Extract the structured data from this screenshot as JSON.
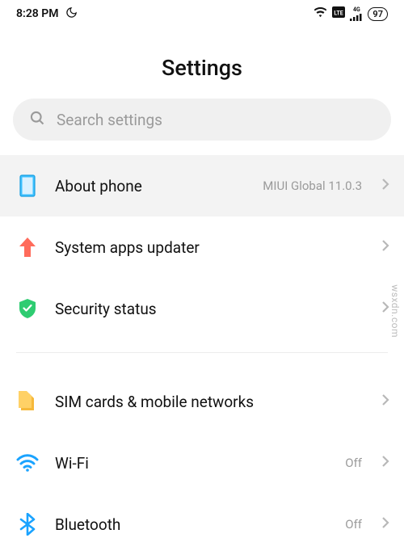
{
  "status": {
    "time": "8:28 PM",
    "network_label": "4G",
    "battery": "97"
  },
  "header": {
    "title": "Settings"
  },
  "search": {
    "placeholder": "Search settings"
  },
  "rows": {
    "about": {
      "label": "About phone",
      "value": "MIUI Global 11.0.3"
    },
    "updater": {
      "label": "System apps updater"
    },
    "security": {
      "label": "Security status"
    },
    "sim": {
      "label": "SIM cards & mobile networks"
    },
    "wifi": {
      "label": "Wi-Fi",
      "value": "Off"
    },
    "bluetooth": {
      "label": "Bluetooth",
      "value": "Off"
    }
  },
  "watermark": "wsxdn.com"
}
